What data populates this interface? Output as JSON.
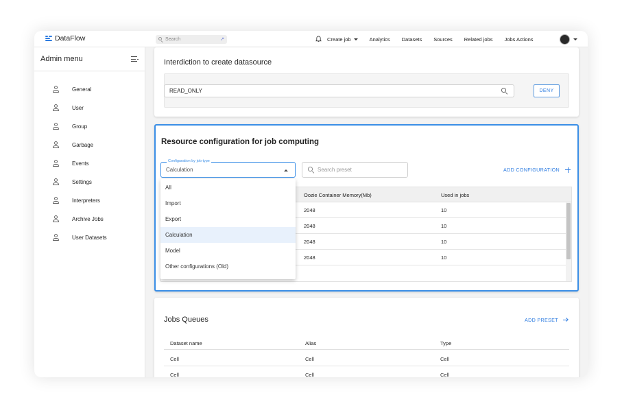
{
  "app": {
    "name": "DataFlow"
  },
  "topnav": {
    "search_placeholder": "Search",
    "links": [
      "Create job",
      "Analytics",
      "Datasets",
      "Sources",
      "Related jobs",
      "Jobs Actions"
    ]
  },
  "sidebar": {
    "title": "Admin menu",
    "items": [
      "General",
      "User",
      "Group",
      "Garbage",
      "Events",
      "Settings",
      "Interpreters",
      "Archive Jobs",
      "User Datasets"
    ]
  },
  "interdiction": {
    "title": "Interdiction to create datasource",
    "input_value": "READ_ONLY",
    "deny_label": "DENY"
  },
  "resource": {
    "title": "Resource configuration for job computing",
    "select_label": "Configuration by job type",
    "select_value": "Calculation",
    "search_placeholder": "Search preset",
    "add_label": "ADD CONFIGURATION",
    "dropdown_options": [
      "All",
      "Import",
      "Export",
      "Calculation",
      "Model",
      "Other configurations (Old)"
    ],
    "selected_option": "Calculation",
    "columns": [
      "Oozie Container Memory(Mb)",
      "Used in jobs"
    ],
    "rows": [
      [
        "2048",
        "10"
      ],
      [
        "2048",
        "10"
      ],
      [
        "2048",
        "10"
      ],
      [
        "2048",
        "10"
      ]
    ]
  },
  "queues": {
    "title": "Jobs Queues",
    "add_label": "ADD PRESET",
    "columns": [
      "Dataset name",
      "Alias",
      "Type"
    ],
    "rows": [
      [
        "Cell",
        "Cell",
        "Cell"
      ],
      [
        "Cell",
        "Cell",
        "Cell"
      ]
    ]
  },
  "colors": {
    "accent": "#2f7de1",
    "focus_border": "#3a8ee6",
    "selected_bg": "#e8f1fc"
  }
}
